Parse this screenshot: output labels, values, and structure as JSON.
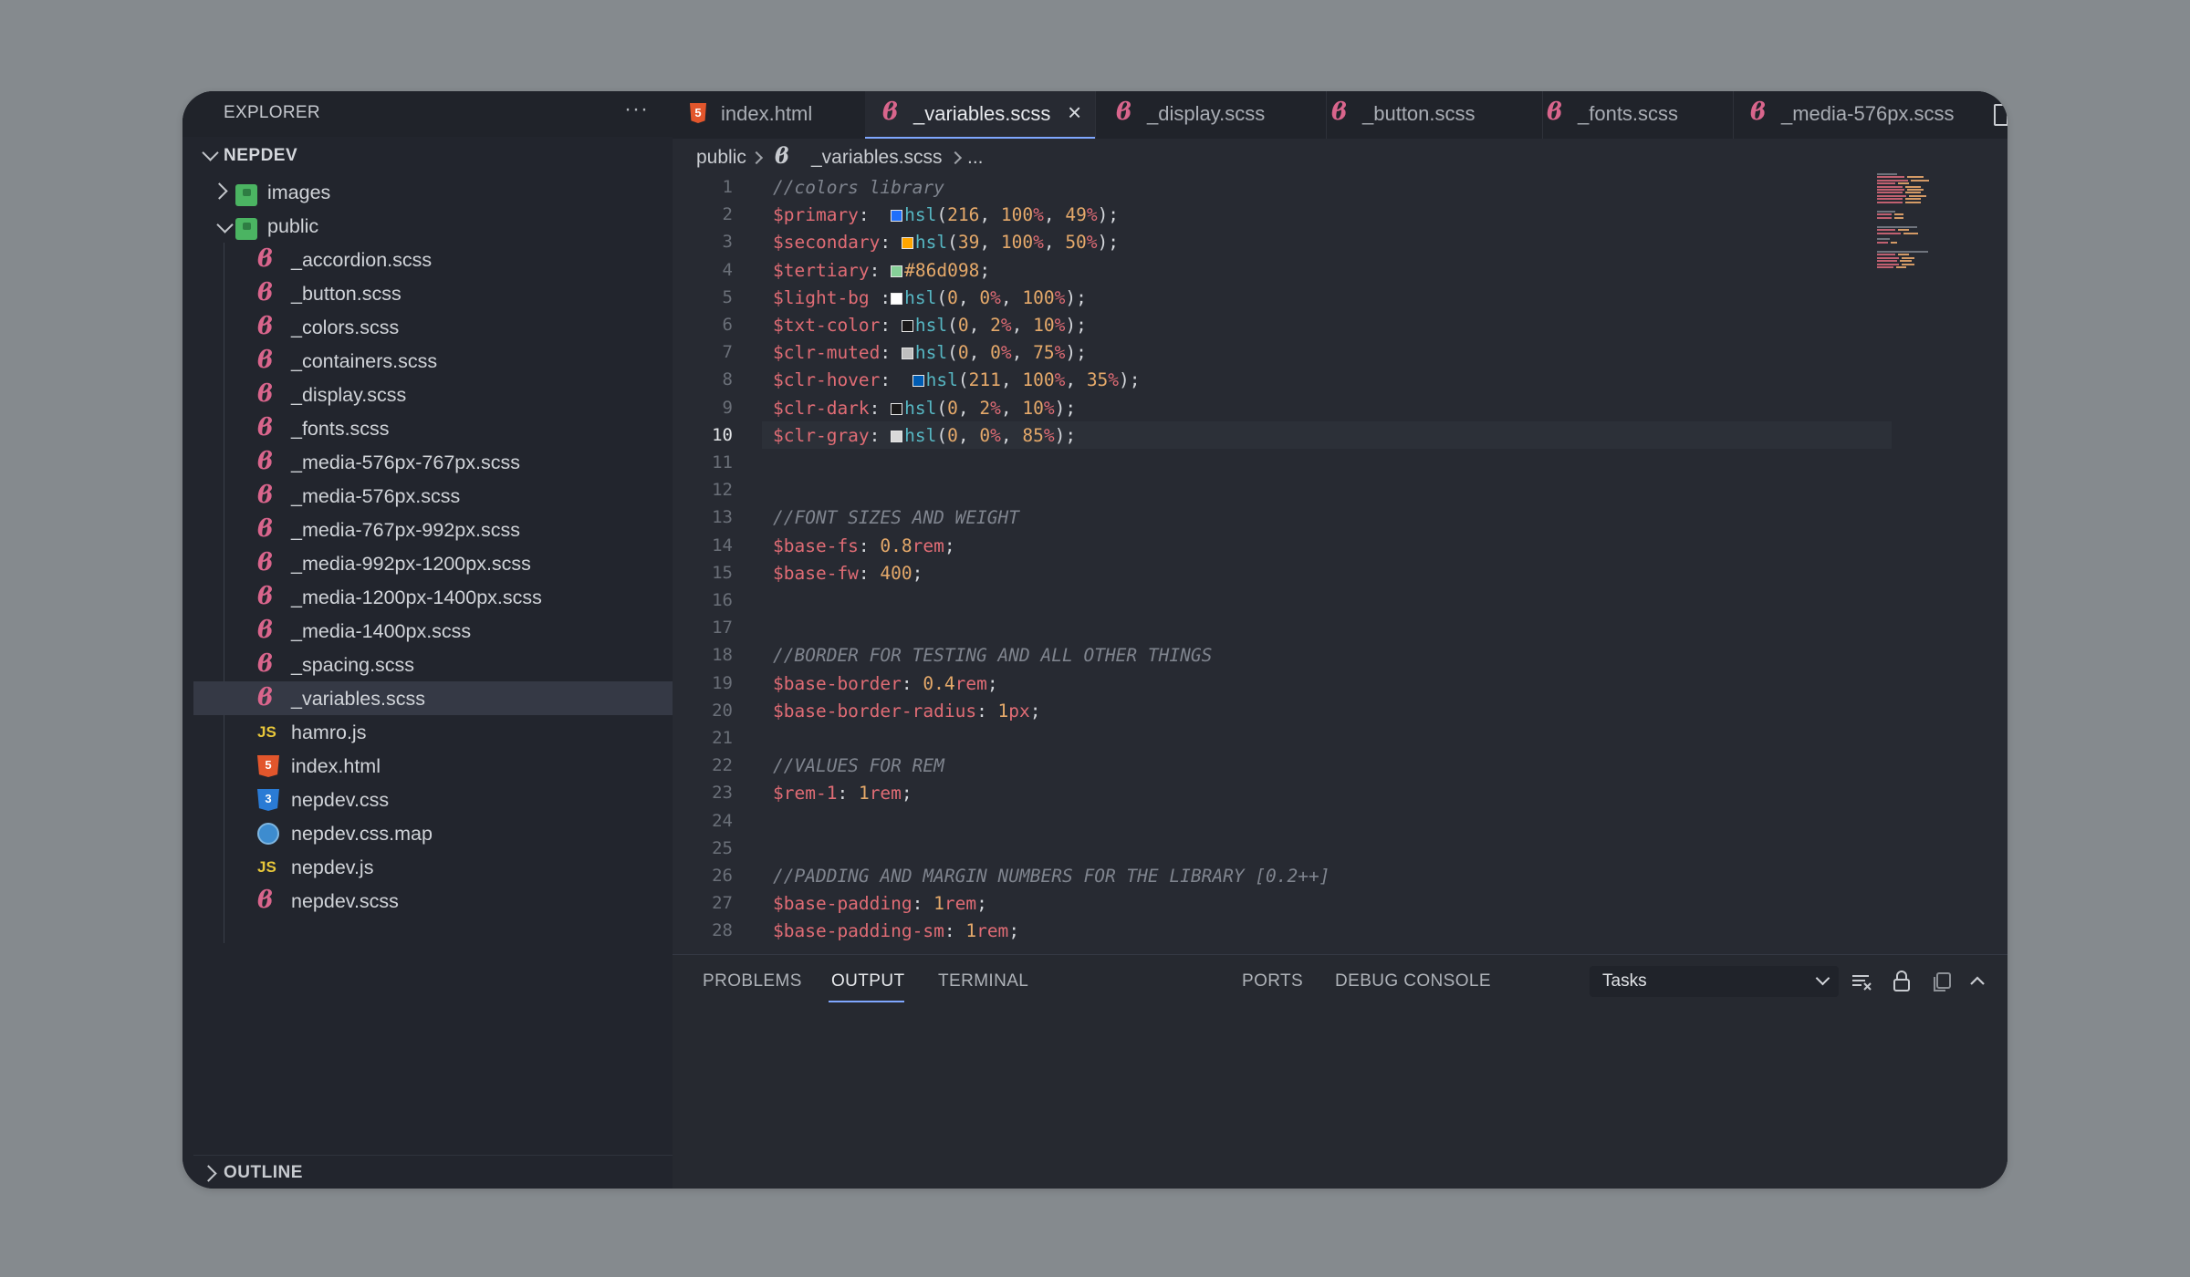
{
  "sidebar": {
    "title": "EXPLORER",
    "more_icon": "ellipsis-icon",
    "project": "NEPDEV",
    "tree": [
      {
        "label": "images",
        "type": "folder",
        "icon": "image-folder-icon",
        "depth": 1,
        "expanded": false
      },
      {
        "label": "public",
        "type": "folder",
        "icon": "public-folder-icon",
        "depth": 1,
        "expanded": true
      },
      {
        "label": "_accordion.scss",
        "type": "sass",
        "depth": 2
      },
      {
        "label": "_button.scss",
        "type": "sass",
        "depth": 2
      },
      {
        "label": "_colors.scss",
        "type": "sass",
        "depth": 2
      },
      {
        "label": "_containers.scss",
        "type": "sass",
        "depth": 2
      },
      {
        "label": "_display.scss",
        "type": "sass",
        "depth": 2
      },
      {
        "label": "_fonts.scss",
        "type": "sass",
        "depth": 2
      },
      {
        "label": "_media-576px-767px.scss",
        "type": "sass",
        "depth": 2
      },
      {
        "label": "_media-576px.scss",
        "type": "sass",
        "depth": 2
      },
      {
        "label": "_media-767px-992px.scss",
        "type": "sass",
        "depth": 2
      },
      {
        "label": "_media-992px-1200px.scss",
        "type": "sass",
        "depth": 2
      },
      {
        "label": "_media-1200px-1400px.scss",
        "type": "sass",
        "depth": 2
      },
      {
        "label": "_media-1400px.scss",
        "type": "sass",
        "depth": 2
      },
      {
        "label": "_spacing.scss",
        "type": "sass",
        "depth": 2
      },
      {
        "label": "_variables.scss",
        "type": "sass",
        "depth": 2,
        "active": true
      },
      {
        "label": "hamro.js",
        "type": "js",
        "depth": 2
      },
      {
        "label": "index.html",
        "type": "html",
        "depth": 2
      },
      {
        "label": "nepdev.css",
        "type": "css",
        "depth": 2
      },
      {
        "label": "nepdev.css.map",
        "type": "map",
        "depth": 2
      },
      {
        "label": "nepdev.js",
        "type": "js",
        "depth": 2
      },
      {
        "label": "nepdev.scss",
        "type": "sass",
        "depth": 2
      }
    ],
    "outline": "OUTLINE"
  },
  "tabs": [
    {
      "label": "index.html",
      "type": "html"
    },
    {
      "label": "_variables.scss",
      "type": "sass",
      "active": true
    },
    {
      "label": "_display.scss",
      "type": "sass"
    },
    {
      "label": "_button.scss",
      "type": "sass"
    },
    {
      "label": "_fonts.scss",
      "type": "sass"
    },
    {
      "label": "_media-576px.scss",
      "type": "sass"
    }
  ],
  "breadcrumb": [
    "public",
    "_variables.scss",
    "..."
  ],
  "editor": {
    "current_line": 10,
    "lines": [
      {
        "n": 1,
        "tokens": [
          [
            "comment",
            "//colors library"
          ]
        ]
      },
      {
        "n": 2,
        "tokens": [
          [
            "var",
            "$primary"
          ],
          [
            "p",
            ":  "
          ],
          [
            "swatch",
            "#1f6ffa"
          ],
          [
            "fn",
            "hsl"
          ],
          [
            "p",
            "("
          ],
          [
            "num",
            "216"
          ],
          [
            "p",
            ", "
          ],
          [
            "num",
            "100"
          ],
          [
            "unit",
            "%"
          ],
          [
            "p",
            ", "
          ],
          [
            "num",
            "49"
          ],
          [
            "unit",
            "%"
          ],
          [
            "p",
            ");"
          ]
        ]
      },
      {
        "n": 3,
        "tokens": [
          [
            "var",
            "$secondary"
          ],
          [
            "p",
            ": "
          ],
          [
            "swatch",
            "#ffa500"
          ],
          [
            "fn",
            "hsl"
          ],
          [
            "p",
            "("
          ],
          [
            "num",
            "39"
          ],
          [
            "p",
            ", "
          ],
          [
            "num",
            "100"
          ],
          [
            "unit",
            "%"
          ],
          [
            "p",
            ", "
          ],
          [
            "num",
            "50"
          ],
          [
            "unit",
            "%"
          ],
          [
            "p",
            ");"
          ]
        ]
      },
      {
        "n": 4,
        "tokens": [
          [
            "var",
            "$tertiary"
          ],
          [
            "p",
            ": "
          ],
          [
            "swatch",
            "#86d098"
          ],
          [
            "hex",
            "#86d098"
          ],
          [
            "p",
            ";"
          ]
        ]
      },
      {
        "n": 5,
        "tokens": [
          [
            "var",
            "$light-bg"
          ],
          [
            "p",
            " :"
          ],
          [
            "swatch",
            "#ffffff"
          ],
          [
            "fn",
            "hsl"
          ],
          [
            "p",
            "("
          ],
          [
            "num",
            "0"
          ],
          [
            "p",
            ", "
          ],
          [
            "num",
            "0"
          ],
          [
            "unit",
            "%"
          ],
          [
            "p",
            ", "
          ],
          [
            "num",
            "100"
          ],
          [
            "unit",
            "%"
          ],
          [
            "p",
            ");"
          ]
        ]
      },
      {
        "n": 6,
        "tokens": [
          [
            "var",
            "$txt-color"
          ],
          [
            "p",
            ": "
          ],
          [
            "swatch",
            "#1a1919"
          ],
          [
            "fn",
            "hsl"
          ],
          [
            "p",
            "("
          ],
          [
            "num",
            "0"
          ],
          [
            "p",
            ", "
          ],
          [
            "num",
            "2"
          ],
          [
            "unit",
            "%"
          ],
          [
            "p",
            ", "
          ],
          [
            "num",
            "10"
          ],
          [
            "unit",
            "%"
          ],
          [
            "p",
            ");"
          ]
        ]
      },
      {
        "n": 7,
        "tokens": [
          [
            "var",
            "$clr-muted"
          ],
          [
            "p",
            ": "
          ],
          [
            "swatch",
            "#bfbfbf"
          ],
          [
            "fn",
            "hsl"
          ],
          [
            "p",
            "("
          ],
          [
            "num",
            "0"
          ],
          [
            "p",
            ", "
          ],
          [
            "num",
            "0"
          ],
          [
            "unit",
            "%"
          ],
          [
            "p",
            ", "
          ],
          [
            "num",
            "75"
          ],
          [
            "unit",
            "%"
          ],
          [
            "p",
            ");"
          ]
        ]
      },
      {
        "n": 8,
        "tokens": [
          [
            "var",
            "$clr-hover"
          ],
          [
            "p",
            ":  "
          ],
          [
            "swatch",
            "#005cb3"
          ],
          [
            "fn",
            "hsl"
          ],
          [
            "p",
            "("
          ],
          [
            "num",
            "211"
          ],
          [
            "p",
            ", "
          ],
          [
            "num",
            "100"
          ],
          [
            "unit",
            "%"
          ],
          [
            "p",
            ", "
          ],
          [
            "num",
            "35"
          ],
          [
            "unit",
            "%"
          ],
          [
            "p",
            ");"
          ]
        ]
      },
      {
        "n": 9,
        "tokens": [
          [
            "var",
            "$clr-dark"
          ],
          [
            "p",
            ": "
          ],
          [
            "swatch",
            "#1a1919"
          ],
          [
            "fn",
            "hsl"
          ],
          [
            "p",
            "("
          ],
          [
            "num",
            "0"
          ],
          [
            "p",
            ", "
          ],
          [
            "num",
            "2"
          ],
          [
            "unit",
            "%"
          ],
          [
            "p",
            ", "
          ],
          [
            "num",
            "10"
          ],
          [
            "unit",
            "%"
          ],
          [
            "p",
            ");"
          ]
        ]
      },
      {
        "n": 10,
        "tokens": [
          [
            "var",
            "$clr-gray"
          ],
          [
            "p",
            ": "
          ],
          [
            "swatch",
            "#d9d9d9"
          ],
          [
            "fn",
            "hsl"
          ],
          [
            "p",
            "("
          ],
          [
            "num",
            "0"
          ],
          [
            "p",
            ", "
          ],
          [
            "num",
            "0"
          ],
          [
            "unit",
            "%"
          ],
          [
            "p",
            ", "
          ],
          [
            "num",
            "85"
          ],
          [
            "unit",
            "%"
          ],
          [
            "p",
            ");"
          ]
        ]
      },
      {
        "n": 11,
        "tokens": []
      },
      {
        "n": 12,
        "tokens": []
      },
      {
        "n": 13,
        "tokens": [
          [
            "comment",
            "//FONT SIZES AND WEIGHT"
          ]
        ]
      },
      {
        "n": 14,
        "tokens": [
          [
            "var",
            "$base-fs"
          ],
          [
            "p",
            ": "
          ],
          [
            "num",
            "0.8"
          ],
          [
            "unit",
            "rem"
          ],
          [
            "p",
            ";"
          ]
        ]
      },
      {
        "n": 15,
        "tokens": [
          [
            "var",
            "$base-fw"
          ],
          [
            "p",
            ": "
          ],
          [
            "num",
            "400"
          ],
          [
            "p",
            ";"
          ]
        ]
      },
      {
        "n": 16,
        "tokens": []
      },
      {
        "n": 17,
        "tokens": []
      },
      {
        "n": 18,
        "tokens": [
          [
            "comment",
            "//BORDER FOR TESTING AND ALL OTHER THINGS"
          ]
        ]
      },
      {
        "n": 19,
        "tokens": [
          [
            "var",
            "$base-border"
          ],
          [
            "p",
            ": "
          ],
          [
            "num",
            "0.4"
          ],
          [
            "unit",
            "rem"
          ],
          [
            "p",
            ";"
          ]
        ]
      },
      {
        "n": 20,
        "tokens": [
          [
            "var",
            "$base-border-radius"
          ],
          [
            "p",
            ": "
          ],
          [
            "num",
            "1"
          ],
          [
            "unit",
            "px"
          ],
          [
            "p",
            ";"
          ]
        ]
      },
      {
        "n": 21,
        "tokens": []
      },
      {
        "n": 22,
        "tokens": [
          [
            "comment",
            "//VALUES FOR REM"
          ]
        ]
      },
      {
        "n": 23,
        "tokens": [
          [
            "var",
            "$rem-1"
          ],
          [
            "p",
            ": "
          ],
          [
            "num",
            "1"
          ],
          [
            "unit",
            "rem"
          ],
          [
            "p",
            ";"
          ]
        ]
      },
      {
        "n": 24,
        "tokens": []
      },
      {
        "n": 25,
        "tokens": []
      },
      {
        "n": 26,
        "tokens": [
          [
            "comment",
            "//PADDING AND MARGIN NUMBERS FOR THE LIBRARY [0.2++]"
          ]
        ]
      },
      {
        "n": 27,
        "tokens": [
          [
            "var",
            "$base-padding"
          ],
          [
            "p",
            ": "
          ],
          [
            "num",
            "1"
          ],
          [
            "unit",
            "rem"
          ],
          [
            "p",
            ";"
          ]
        ]
      },
      {
        "n": 28,
        "tokens": [
          [
            "var",
            "$base-padding-sm"
          ],
          [
            "p",
            ": "
          ],
          [
            "num",
            "1"
          ],
          [
            "unit",
            "rem"
          ],
          [
            "p",
            ";"
          ]
        ]
      }
    ]
  },
  "panel": {
    "tabs": [
      {
        "label": "PROBLEMS"
      },
      {
        "label": "OUTPUT",
        "active": true
      },
      {
        "label": "TERMINAL"
      },
      {
        "label": "PORTS"
      },
      {
        "label": "DEBUG CONSOLE"
      }
    ],
    "select_value": "Tasks",
    "icons": [
      "clear-output-icon",
      "lock-icon",
      "copy-icon",
      "maximize-panel-icon"
    ]
  },
  "colors": {
    "background": "#858a8e",
    "window": "#252830",
    "accent": "#7fa7ff",
    "variable": "#e06c75",
    "function": "#56b6c2",
    "number": "#e5a96a",
    "comment": "#7f848e"
  }
}
